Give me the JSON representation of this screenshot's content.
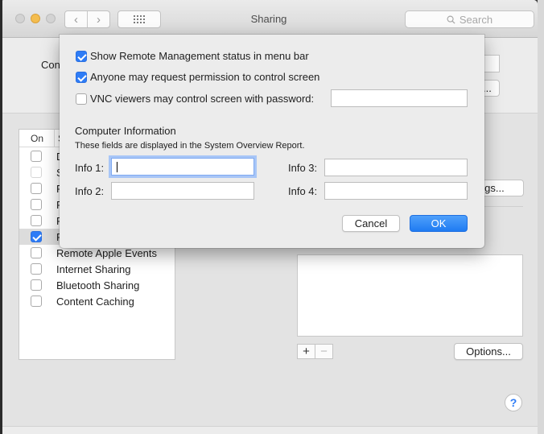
{
  "window": {
    "title": "Sharing",
    "search_placeholder": "Search",
    "nav_back": "‹",
    "nav_forward": "›"
  },
  "background": {
    "computer_name_label_partial": "Con",
    "edit_button_partial": "...",
    "list_header_on": "On",
    "list_header_service_partial": "S",
    "services": [
      {
        "label": "D",
        "checked": false,
        "enabled": true
      },
      {
        "label": "S",
        "checked": false,
        "enabled": false
      },
      {
        "label": "F",
        "checked": false,
        "enabled": true
      },
      {
        "label": "P",
        "checked": false,
        "enabled": true
      },
      {
        "label": "R",
        "checked": false,
        "enabled": true
      },
      {
        "label": "R",
        "checked": true,
        "enabled": true
      },
      {
        "label": "Remote Apple Events",
        "checked": false,
        "enabled": true
      },
      {
        "label": "Internet Sharing",
        "checked": false,
        "enabled": true
      },
      {
        "label": "Bluetooth Sharing",
        "checked": false,
        "enabled": true
      },
      {
        "label": "Content Caching",
        "checked": false,
        "enabled": true
      }
    ],
    "computer_settings_partial": "ings...",
    "add_label": "+",
    "remove_label": "−",
    "options_label": "Options...",
    "help_label": "?"
  },
  "sheet": {
    "show_status_label": "Show Remote Management status in menu bar",
    "show_status_checked": true,
    "anyone_request_label": "Anyone may request permission to control screen",
    "anyone_request_checked": true,
    "vnc_label": "VNC viewers may control screen with password:",
    "vnc_checked": false,
    "vnc_password_value": "",
    "computer_info_title": "Computer Information",
    "computer_info_subtitle": "These fields are displayed in the System Overview Report.",
    "info1_label": "Info 1:",
    "info2_label": "Info 2:",
    "info3_label": "Info 3:",
    "info4_label": "Info 4:",
    "info1_value": "",
    "info2_value": "",
    "info3_value": "",
    "info4_value": "",
    "cancel_label": "Cancel",
    "ok_label": "OK"
  },
  "colors": {
    "accent": "#2e7cf6",
    "window_bg": "#ececec",
    "minimize_light": "#f4bd4f"
  }
}
